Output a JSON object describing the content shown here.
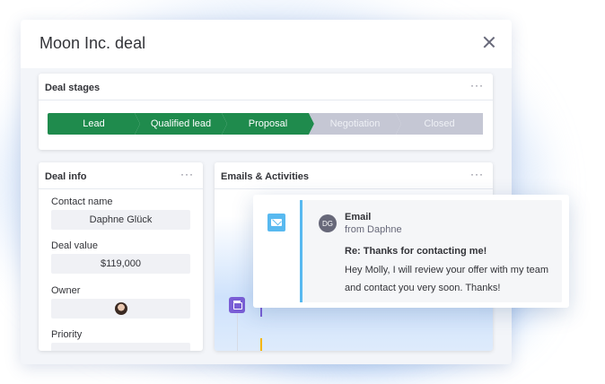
{
  "modal": {
    "title": "Moon Inc. deal"
  },
  "deal_stages": {
    "title": "Deal stages",
    "menu": "···",
    "stages": [
      {
        "label": "Lead",
        "status": "done"
      },
      {
        "label": "Qualified lead",
        "status": "done"
      },
      {
        "label": "Proposal",
        "status": "done"
      },
      {
        "label": "Negotiation",
        "status": "todo"
      },
      {
        "label": "Closed",
        "status": "todo"
      }
    ]
  },
  "deal_info": {
    "title": "Deal info",
    "menu": "···",
    "contact_label": "Contact name",
    "contact_value": "Daphne Glück",
    "value_label": "Deal value",
    "value_value": "$119,000",
    "owner_label": "Owner",
    "priority_label": "Priority"
  },
  "emails": {
    "title": "Emails & Activities",
    "menu": "···"
  },
  "email_popup": {
    "avatar_initials": "DG",
    "type": "Email",
    "from": "from Daphne",
    "subject": "Re: Thanks for contacting me!",
    "body": "Hey Molly, I will review your offer with my team and contact you very soon. Thanks!"
  },
  "colors": {
    "done_stage": "#1f8b4d",
    "todo_stage": "#c5c7d4",
    "email_accent": "#58b9f0",
    "calendar": "#7b5fd6"
  }
}
